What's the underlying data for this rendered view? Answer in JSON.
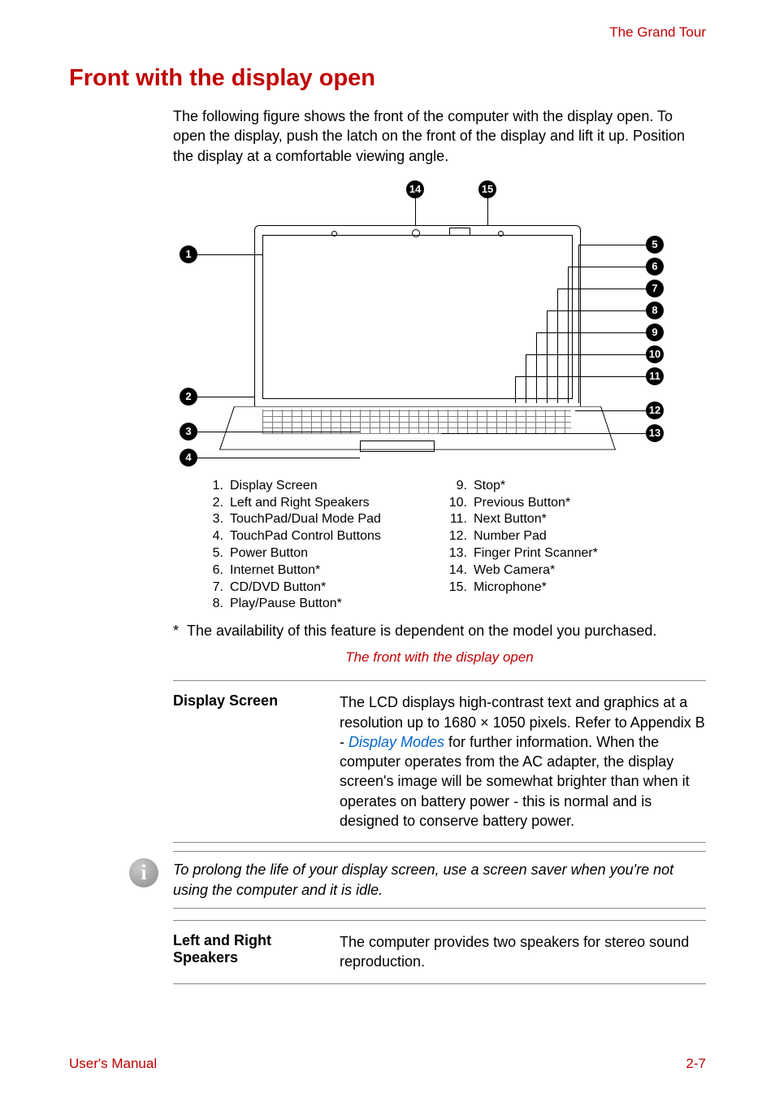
{
  "header": {
    "right": "The Grand Tour"
  },
  "section_title": "Front with the display open",
  "intro": "The following figure shows the front of the computer with the display open. To open the display, push the latch on the front of the display and lift it up. Position the display at a comfortable viewing angle.",
  "callouts": {
    "left": [
      "1",
      "2",
      "3",
      "4"
    ],
    "right": [
      "5",
      "6",
      "7",
      "8",
      "9",
      "10",
      "11",
      "12",
      "13"
    ],
    "top": [
      "14",
      "15"
    ]
  },
  "legend": {
    "col1": [
      {
        "n": "1.",
        "t": "Display Screen"
      },
      {
        "n": "2.",
        "t": "Left and Right Speakers"
      },
      {
        "n": "3.",
        "t": "TouchPad/Dual Mode Pad"
      },
      {
        "n": "4.",
        "t": "TouchPad Control Buttons"
      },
      {
        "n": "5.",
        "t": "Power Button"
      },
      {
        "n": "6.",
        "t": "Internet Button*"
      },
      {
        "n": "7.",
        "t": "CD/DVD Button*"
      },
      {
        "n": "8.",
        "t": "Play/Pause Button*"
      }
    ],
    "col2": [
      {
        "n": "9.",
        "t": "Stop*"
      },
      {
        "n": "10.",
        "t": "Previous Button*"
      },
      {
        "n": "11.",
        "t": "Next Button*"
      },
      {
        "n": "12.",
        "t": "Number Pad"
      },
      {
        "n": "13.",
        "t": "Finger Print Scanner*"
      },
      {
        "n": "14.",
        "t": "Web Camera*"
      },
      {
        "n": "15.",
        "t": "Microphone*"
      }
    ]
  },
  "footnote_marker": "*",
  "footnote_text": "The availability of this feature is dependent on the model you purchased.",
  "caption": "The front with the display open",
  "defs": [
    {
      "term": "Display Screen",
      "desc_pre": "The LCD displays high-contrast text and graphics at a resolution up to 1680 × 1050 pixels. Refer to Appendix B - ",
      "link": "Display Modes",
      "desc_post": " for further information. When the computer operates from the AC adapter, the display screen's image will be somewhat brighter than when it operates on battery power - this is normal and is designed to conserve battery power."
    }
  ],
  "note": "To prolong the life of your display screen, use a screen saver when you're not using the computer and it is idle.",
  "defs2": [
    {
      "term": "Left and Right Speakers",
      "desc": "The computer provides two speakers for stereo sound reproduction."
    }
  ],
  "footer": {
    "left": "User's Manual",
    "right": "2-7"
  },
  "info_glyph": "i"
}
